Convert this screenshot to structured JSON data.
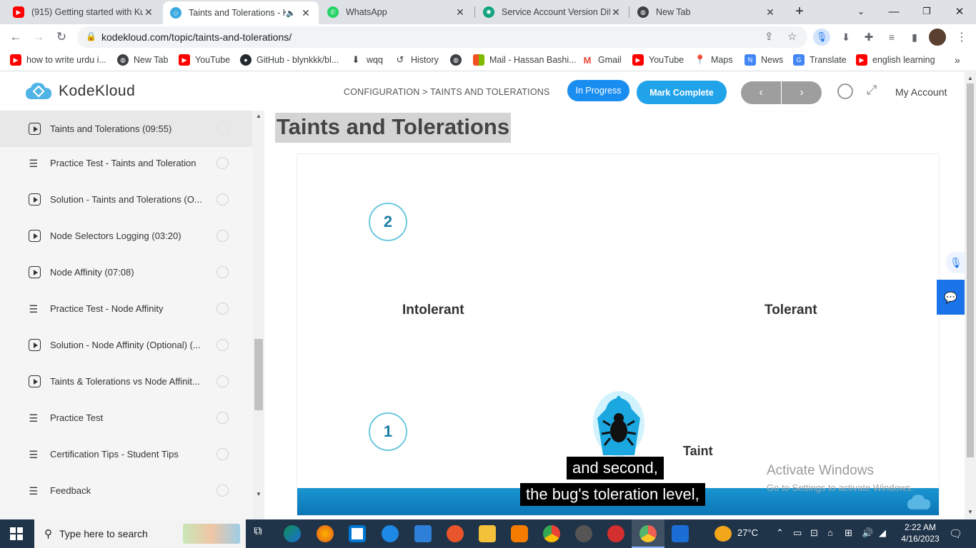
{
  "browser": {
    "tabs": [
      {
        "title": "(915) Getting started with Ku",
        "icon": "youtube-icon",
        "color": "#ff0000"
      },
      {
        "title": "Taints and Tolerations - K",
        "icon": "kodekloud-icon",
        "color": "#3ba9e0",
        "active": true
      },
      {
        "title": "WhatsApp",
        "icon": "whatsapp-icon",
        "color": "#25d366"
      },
      {
        "title": "Service Account Version Diffe",
        "icon": "openai-icon",
        "color": "#10a37f"
      },
      {
        "title": "New Tab",
        "icon": "globe-icon",
        "color": "#3c4043"
      }
    ],
    "url": "kodekloud.com/topic/taints-and-tolerations/",
    "bookmarks": [
      {
        "label": "how to write urdu i...",
        "icon": "youtube-icon"
      },
      {
        "label": "New Tab",
        "icon": "globe-icon"
      },
      {
        "label": "YouTube",
        "icon": "youtube-icon"
      },
      {
        "label": "GitHub - blynkkk/bl...",
        "icon": "github-icon"
      },
      {
        "label": "wqq",
        "icon": "download-icon"
      },
      {
        "label": "History",
        "icon": "history-icon"
      },
      {
        "label": "",
        "icon": "globe-icon"
      },
      {
        "label": "Mail - Hassan Bashi...",
        "icon": "microsoft-icon"
      },
      {
        "label": "Gmail",
        "icon": "gmail-icon"
      },
      {
        "label": "YouTube",
        "icon": "youtube-icon"
      },
      {
        "label": "Maps",
        "icon": "maps-icon"
      },
      {
        "label": "News",
        "icon": "news-icon"
      },
      {
        "label": "Translate",
        "icon": "translate-icon"
      },
      {
        "label": "english learning",
        "icon": "youtube-icon"
      }
    ]
  },
  "header": {
    "logo": "KodeKloud",
    "breadcrumb": "CONFIGURATION > TAINTS AND TOLERATIONS",
    "status": "In Progress",
    "mark_complete": "Mark Complete",
    "prev": "‹",
    "next": "›",
    "account": "My Account"
  },
  "sidebar": {
    "items": [
      {
        "label": "Taints and Tolerations (09:55)",
        "type": "video",
        "active": true
      },
      {
        "label": "Practice Test - Taints and Toleration",
        "type": "lab"
      },
      {
        "label": "Solution - Taints and Tolerations (O...",
        "type": "video"
      },
      {
        "label": "Node Selectors Logging (03:20)",
        "type": "video"
      },
      {
        "label": "Node Affinity (07:08)",
        "type": "video"
      },
      {
        "label": "Practice Test - Node Affinity",
        "type": "lab"
      },
      {
        "label": "Solution - Node Affinity (Optional) (...",
        "type": "video"
      },
      {
        "label": "Taints & Tolerations vs Node Affinit...",
        "type": "video"
      },
      {
        "label": "Practice Test",
        "type": "lab"
      },
      {
        "label": "Certification Tips - Student Tips",
        "type": "lab"
      },
      {
        "label": "Feedback",
        "type": "lab"
      }
    ]
  },
  "main": {
    "title": "Taints and Tolerations",
    "video": {
      "num2": "2",
      "num1": "1",
      "intolerant": "Intolerant",
      "tolerant": "Tolerant",
      "taint": "Taint",
      "caption1": "and second,",
      "caption2": "the bug's toleration level,",
      "activate1": "Activate Windows",
      "activate2": "Go to Settings to activate Windows."
    }
  },
  "taskbar": {
    "search_placeholder": "Type here to search",
    "weather": "27°C",
    "time": "2:22 AM",
    "date": "4/16/2023"
  }
}
